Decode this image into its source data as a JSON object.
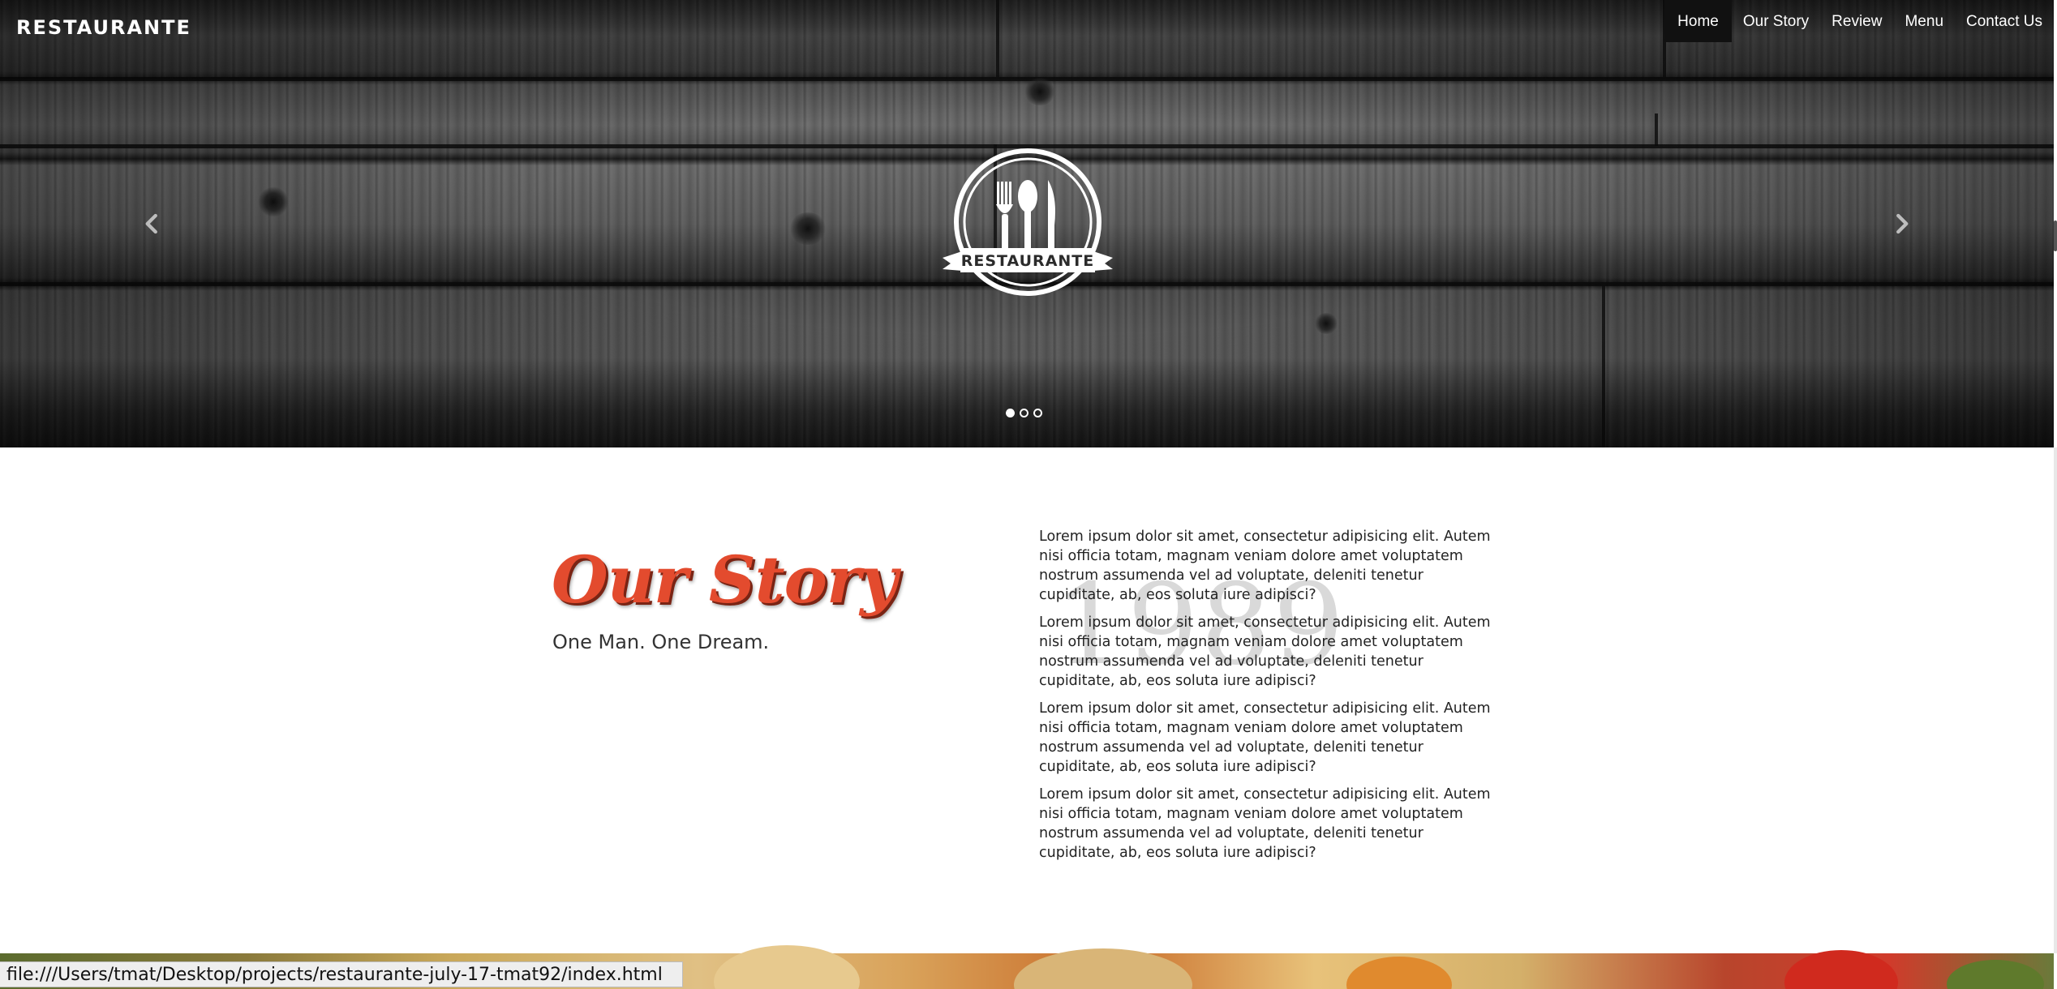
{
  "brand": "RESTAURANTE",
  "nav": {
    "items": [
      "Home",
      "Our Story",
      "Review",
      "Menu",
      "Contact Us"
    ],
    "active": "Home"
  },
  "hero": {
    "logo_text": "RESTAURANTE",
    "slides_total": 3,
    "active_slide": 1
  },
  "story": {
    "title": "Our Story",
    "subtitle": "One Man. One Dream.",
    "year": "1989",
    "paragraphs": [
      "Lorem ipsum dolor sit amet, consectetur adipisicing elit. Autem nisi officia totam, magnam veniam dolore amet voluptatem nostrum assumenda vel ad voluptate, deleniti tenetur cupiditate, ab, eos soluta iure adipisci?",
      "Lorem ipsum dolor sit amet, consectetur adipisicing elit. Autem nisi officia totam, magnam veniam dolore amet voluptatem nostrum assumenda vel ad voluptate, deleniti tenetur cupiditate, ab, eos soluta iure adipisci?",
      "Lorem ipsum dolor sit amet, consectetur adipisicing elit. Autem nisi officia totam, magnam veniam dolore amet voluptatem nostrum assumenda vel ad voluptate, deleniti tenetur cupiditate, ab, eos soluta iure adipisci?",
      "Lorem ipsum dolor sit amet, consectetur adipisicing elit. Autem nisi officia totam, magnam veniam dolore amet voluptatem nostrum assumenda vel ad voluptate, deleniti tenetur cupiditate, ab, eos soluta iure adipisci?"
    ]
  },
  "status_bar": "file:///Users/tmat/Desktop/projects/restaurante-july-17-tmat92/index.html",
  "colors": {
    "accent": "#e34b2e",
    "nav_active_bg": "#111111"
  },
  "icons": {
    "prev": "chevron-left-icon",
    "next": "chevron-right-icon",
    "logo": "cutlery-badge-icon"
  }
}
